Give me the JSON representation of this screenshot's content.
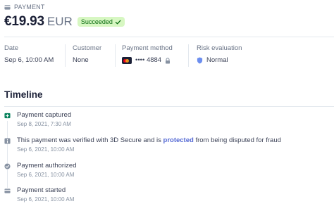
{
  "header": {
    "section_label": "PAYMENT",
    "amount": "€19.93",
    "currency": "EUR",
    "status_badge": "Succeeded"
  },
  "summary": {
    "date": {
      "label": "Date",
      "value": "Sep 6, 10:00 AM"
    },
    "customer": {
      "label": "Customer",
      "value": "None"
    },
    "payment_method": {
      "label": "Payment method",
      "value": "•••• 4884",
      "card_brand": "mastercard"
    },
    "risk": {
      "label": "Risk evaluation",
      "value": "Normal"
    }
  },
  "timeline": {
    "title": "Timeline",
    "items": [
      {
        "text": "Payment captured",
        "time": "Sep 8, 2021, 7:30 AM",
        "icon": "captured-icon"
      },
      {
        "text_before": "This payment was verified with 3D Secure and is ",
        "link": "protected",
        "text_after": " from being disputed for fraud",
        "time": "Sep 6, 2021, 10:00 AM",
        "icon": "info-icon"
      },
      {
        "text": "Payment authorized",
        "time": "Sep 6, 2021, 10:00 AM",
        "icon": "check-circle-icon"
      },
      {
        "text": "Payment started",
        "time": "Sep 6, 2021, 10:00 AM",
        "icon": "card-icon"
      }
    ]
  },
  "colors": {
    "badge_bg": "#d7f7c2",
    "badge_text": "#05690d",
    "link": "#5469d4",
    "shield": "#6c8eef"
  }
}
